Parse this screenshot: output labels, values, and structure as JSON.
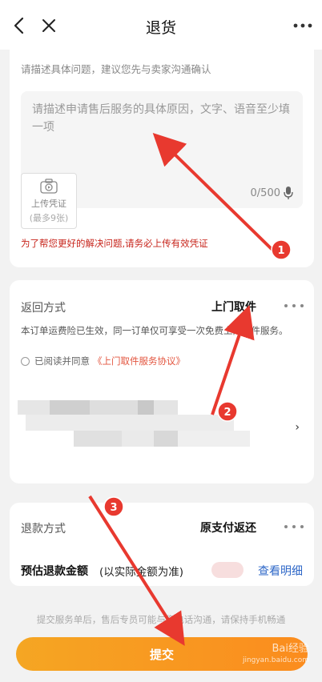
{
  "header": {
    "title": "退货"
  },
  "reason": {
    "hint": "请描述具体问题，建议您先与卖家沟通确认",
    "placeholder": "请描述申请售后服务的具体原因，文字、语音至少填一项",
    "counter": "0/500"
  },
  "upload": {
    "label": "上传凭证",
    "limit": "(最多9张)"
  },
  "warning": "为了帮您更好的解决问题,请务必上传有效凭证",
  "return": {
    "label": "返回方式",
    "value": "上门取件",
    "insurance": "本订单运费险已生效，同一订单仅可享受一次免费上门取件服务。",
    "agree_prefix": "已阅读并同意",
    "agreement": "《上门取件服务协议》",
    "chevron": "›"
  },
  "refund": {
    "label": "退款方式",
    "value": "原支付返还",
    "amount_label": "预估退款金额",
    "amount_note": "(以实际金额为准)",
    "detail_link": "查看明细"
  },
  "footer": {
    "note": "提交服务单后，售后专员可能与您电话沟通，请保持手机畅通",
    "submit": "提交"
  },
  "watermark": {
    "brand": "Bai经验",
    "site": "jingyan.baidu.com"
  },
  "annotations": {
    "badges": [
      "1",
      "2",
      "3"
    ],
    "color": "#e8392f"
  },
  "colors": {
    "accent": "#fb8c1e",
    "link": "#2f68c8",
    "warning": "#c7241b"
  }
}
